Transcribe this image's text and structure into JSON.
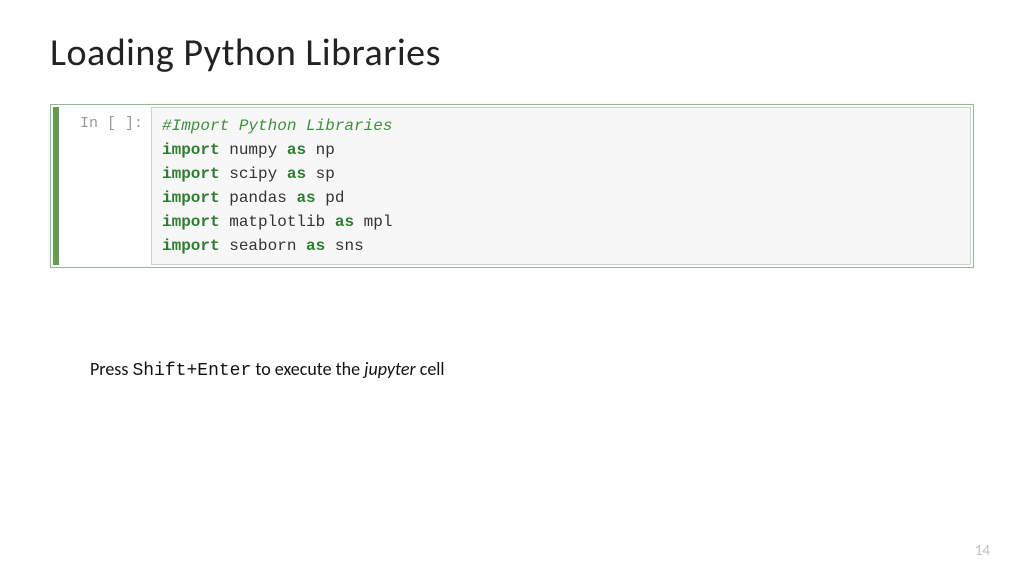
{
  "title": "Loading Python Libraries",
  "prompt": "In [ ]:",
  "code": {
    "comment": "#Import Python Libraries",
    "lines": [
      {
        "kw1": "import",
        "module": "numpy",
        "kw2": "as",
        "alias": "np"
      },
      {
        "kw1": "import",
        "module": "scipy",
        "kw2": "as",
        "alias": "sp"
      },
      {
        "kw1": "import",
        "module": "pandas",
        "kw2": "as",
        "alias": "pd"
      },
      {
        "kw1": "import",
        "module": "matplotlib",
        "kw2": "as",
        "alias": "mpl"
      },
      {
        "kw1": "import",
        "module": "seaborn",
        "kw2": "as",
        "alias": "sns"
      }
    ]
  },
  "instruction": {
    "pre": "Press ",
    "keys": "Shift+Enter",
    "mid": " to execute the ",
    "em": "jupyter",
    "post": " cell"
  },
  "page_number": "14"
}
